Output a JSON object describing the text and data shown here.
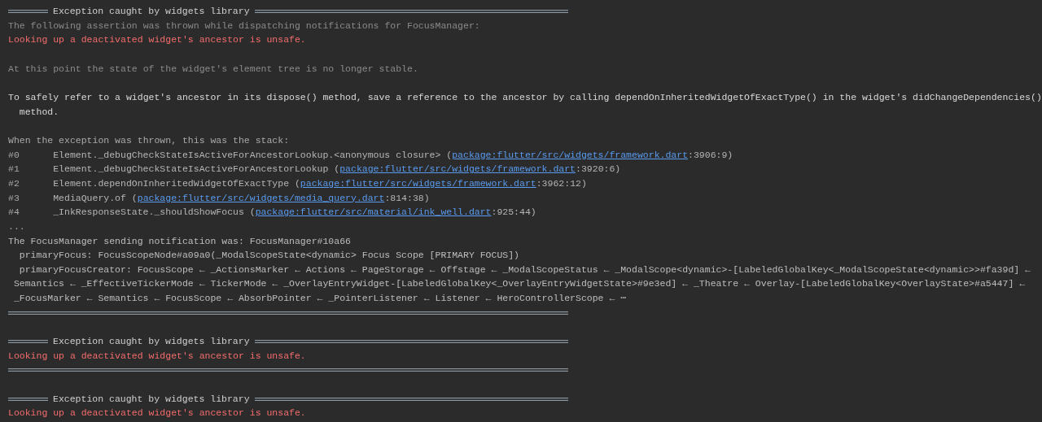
{
  "console": [
    {
      "title": "Exception caught by widgets library",
      "closed": true,
      "paragraphs": [
        [
          {
            "kind": "text",
            "color": "#8a8a8a",
            "text": "The following assertion was thrown while dispatching notifications for FocusManager:"
          },
          {
            "kind": "text",
            "color": "#f46c6c",
            "text": "Looking up a deactivated widget's ancestor is unsafe."
          }
        ],
        [
          {
            "kind": "text",
            "color": "#8a8a8a",
            "text": "At this point the state of the widget's element tree is no longer stable."
          }
        ],
        [
          {
            "kind": "text",
            "color": "#d8d8d8",
            "text": "To safely refer to a widget's ancestor in its dispose() method, save a reference to the ancestor by calling dependOnInheritedWidgetOfExactType() in the widget's didChangeDependencies()"
          },
          {
            "kind": "indented",
            "color": "#d8d8d8",
            "text": "method."
          }
        ],
        [
          {
            "kind": "text",
            "color": "#a9a9a9",
            "text": "When the exception was thrown, this was the stack:"
          },
          {
            "kind": "frame",
            "number": "#0",
            "call": "Element._debugCheckStateIsActiveForAncestorLookup.<anonymous closure> (",
            "link": "package:flutter/src/widgets/framework.dart",
            "location": ":3906:9)"
          },
          {
            "kind": "frame",
            "number": "#1",
            "call": "Element._debugCheckStateIsActiveForAncestorLookup (",
            "link": "package:flutter/src/widgets/framework.dart",
            "location": ":3920:6)"
          },
          {
            "kind": "frame",
            "number": "#2",
            "call": "Element.dependOnInheritedWidgetOfExactType (",
            "link": "package:flutter/src/widgets/framework.dart",
            "location": ":3962:12)"
          },
          {
            "kind": "frame",
            "number": "#3",
            "call": "MediaQuery.of (",
            "link": "package:flutter/src/widgets/media_query.dart",
            "location": ":814:38)"
          },
          {
            "kind": "frame",
            "number": "#4",
            "call": "_InkResponseState._shouldShowFocus (",
            "link": "package:flutter/src/material/ink_well.dart",
            "location": ":925:44)"
          },
          {
            "kind": "text",
            "text": "..."
          },
          {
            "kind": "text",
            "color": "#bdbdbd",
            "text": "The FocusManager sending notification was: FocusManager#10a66"
          },
          {
            "kind": "indented",
            "color": "#bdbdbd",
            "text": "primaryFocus: FocusScopeNode#a09a0(_ModalScopeState<dynamic> Focus Scope [PRIMARY FOCUS])"
          },
          {
            "kind": "indented",
            "color": "#bdbdbd",
            "text": "primaryFocusCreator: FocusScope ← _ActionsMarker ← Actions ← PageStorage ← Offstage ← _ModalScopeStatus ← _ModalScope<dynamic>-[LabeledGlobalKey<_ModalScopeState<dynamic>>#fa39d] ←"
          },
          {
            "kind": "continued",
            "color": "#bdbdbd",
            "text": "Semantics ← _EffectiveTickerMode ← TickerMode ← _OverlayEntryWidget-[LabeledGlobalKey<_OverlayEntryWidgetState>#9e3ed] ← _Theatre ← Overlay-[LabeledGlobalKey<OverlayState>#a5447] ←"
          },
          {
            "kind": "continued",
            "color": "#bdbdbd",
            "text": "_FocusMarker ← Semantics ← FocusScope ← AbsorbPointer ← _PointerListener ← Listener ← HeroControllerScope ← ⋯"
          }
        ]
      ]
    },
    {
      "title": "Exception caught by widgets library",
      "closed": true,
      "paragraphs": [
        [
          {
            "kind": "text",
            "color": "#f46c6c",
            "text": "Looking up a deactivated widget's ancestor is unsafe."
          }
        ]
      ]
    },
    {
      "title": "Exception caught by widgets library",
      "closed": false,
      "paragraphs": [
        [
          {
            "kind": "text",
            "color": "#f46c6c",
            "text": "Looking up a deactivated widget's ancestor is unsafe."
          }
        ]
      ]
    }
  ]
}
